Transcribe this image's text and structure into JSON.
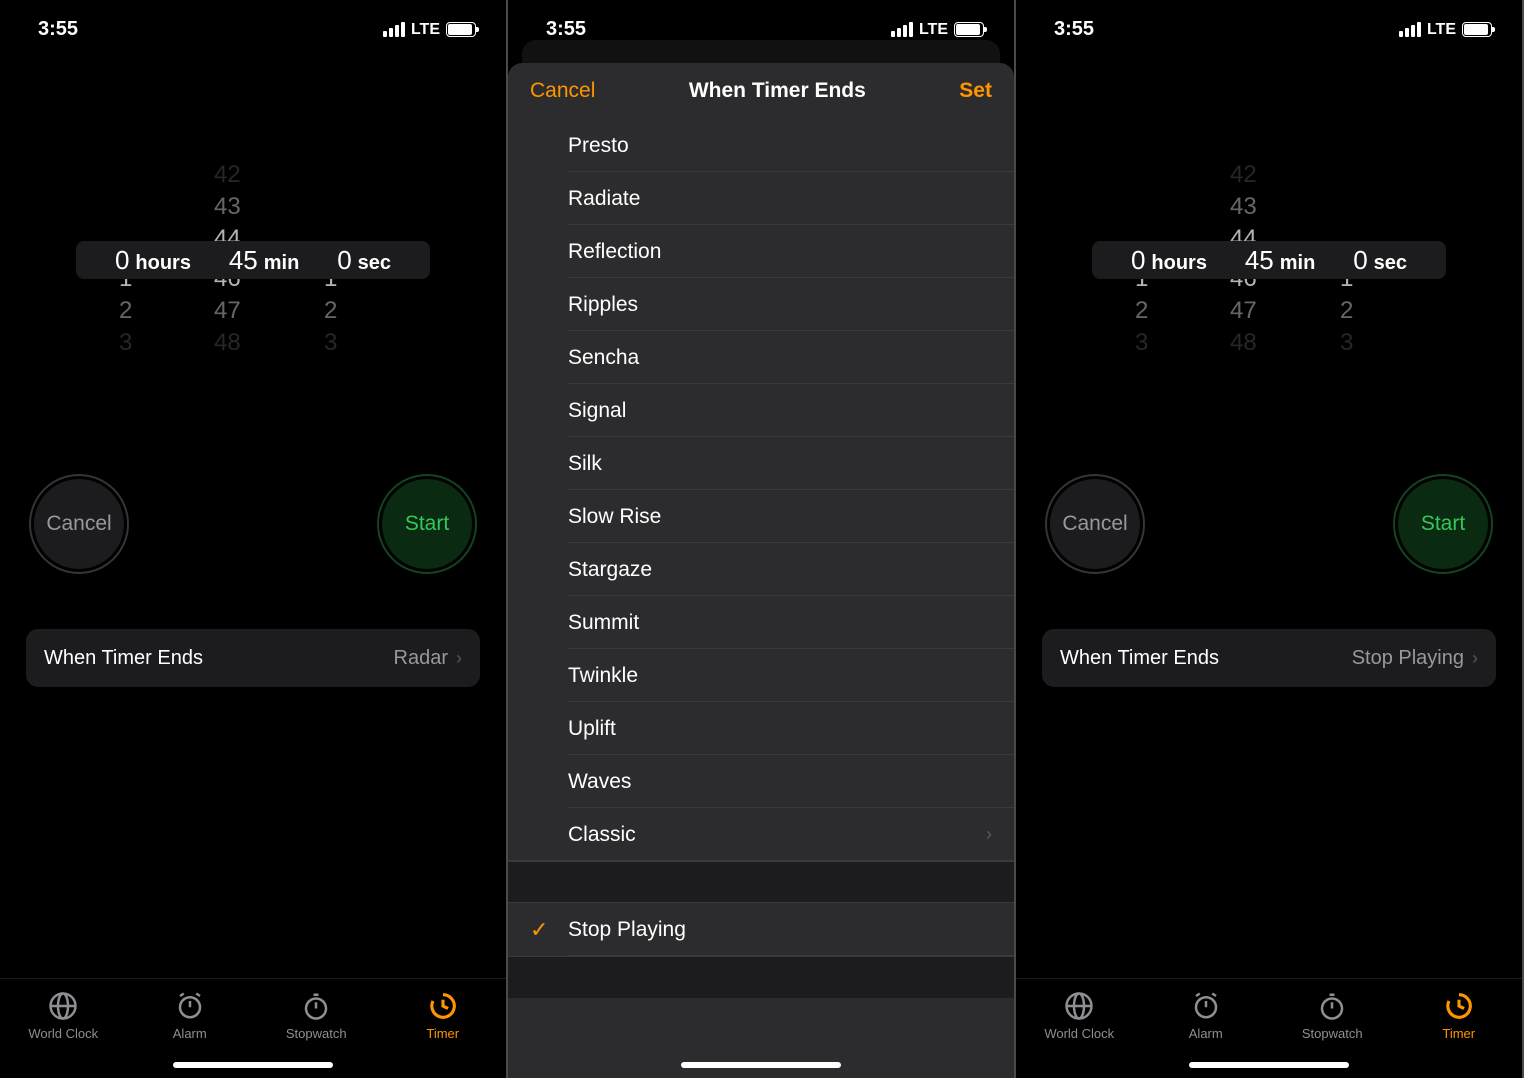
{
  "status": {
    "time": "3:55",
    "net": "LTE"
  },
  "picker": {
    "hours": "0",
    "hours_unit": "hours",
    "min": "45",
    "min_unit": "min",
    "sec": "0",
    "sec_unit": "sec",
    "ghost_min_up": [
      "42",
      "43",
      "44"
    ],
    "ghost_min_down": [
      "46",
      "47",
      "48"
    ],
    "ghost_side_down": [
      "1",
      "2",
      "3"
    ]
  },
  "buttons": {
    "cancel": "Cancel",
    "start": "Start"
  },
  "when": {
    "label": "When Timer Ends",
    "value1": "Radar",
    "value3": "Stop Playing"
  },
  "tabs": {
    "world": "World Clock",
    "alarm": "Alarm",
    "stopwatch": "Stopwatch",
    "timer": "Timer"
  },
  "sheet": {
    "cancel": "Cancel",
    "title": "When Timer Ends",
    "set": "Set",
    "items": [
      "Presto",
      "Radiate",
      "Reflection",
      "Ripples",
      "Sencha",
      "Signal",
      "Silk",
      "Slow Rise",
      "Stargaze",
      "Summit",
      "Twinkle",
      "Uplift",
      "Waves",
      "Classic"
    ],
    "stop": "Stop Playing"
  }
}
